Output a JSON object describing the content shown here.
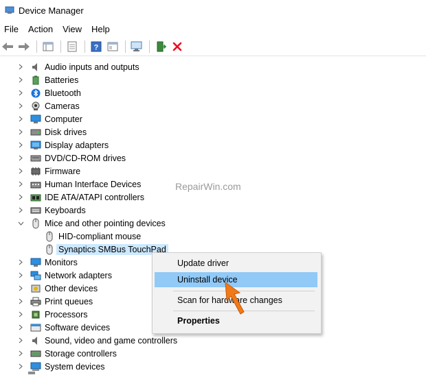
{
  "window": {
    "title": "Device Manager"
  },
  "menu": [
    "File",
    "Action",
    "View",
    "Help"
  ],
  "toolbar_icons": [
    "back-icon",
    "forward-icon",
    "tree-view-icon",
    "properties-icon",
    "help-icon",
    "panel-icon",
    "monitor-scan-icon",
    "update-driver-icon",
    "uninstall-x-icon"
  ],
  "tree": {
    "items": [
      {
        "label": "Audio inputs and outputs",
        "icon": "speaker-icon"
      },
      {
        "label": "Batteries",
        "icon": "battery-icon"
      },
      {
        "label": "Bluetooth",
        "icon": "bluetooth-icon"
      },
      {
        "label": "Cameras",
        "icon": "camera-icon"
      },
      {
        "label": "Computer",
        "icon": "computer-icon"
      },
      {
        "label": "Disk drives",
        "icon": "disk-icon"
      },
      {
        "label": "Display adapters",
        "icon": "display-adapter-icon"
      },
      {
        "label": "DVD/CD-ROM drives",
        "icon": "dvd-icon"
      },
      {
        "label": "Firmware",
        "icon": "firmware-icon"
      },
      {
        "label": "Human Interface Devices",
        "icon": "hid-icon"
      },
      {
        "label": "IDE ATA/ATAPI controllers",
        "icon": "ide-icon"
      },
      {
        "label": "Keyboards",
        "icon": "keyboard-icon"
      },
      {
        "label": "Mice and other pointing devices",
        "icon": "mouse-icon"
      },
      {
        "label": "HID-compliant mouse",
        "icon": "mouse-icon"
      },
      {
        "label": "Synaptics SMBus TouchPad",
        "icon": "mouse-icon"
      },
      {
        "label": "Monitors",
        "icon": "monitor-icon"
      },
      {
        "label": "Network adapters",
        "icon": "network-icon"
      },
      {
        "label": "Other devices",
        "icon": "other-devices-icon"
      },
      {
        "label": "Print queues",
        "icon": "printer-icon"
      },
      {
        "label": "Processors",
        "icon": "processor-icon"
      },
      {
        "label": "Software devices",
        "icon": "software-icon"
      },
      {
        "label": "Sound, video and game controllers",
        "icon": "sound-icon"
      },
      {
        "label": "Storage controllers",
        "icon": "storage-icon"
      },
      {
        "label": "System devices",
        "icon": "system-icon"
      }
    ]
  },
  "watermark": "RepairWin.com",
  "context_menu": {
    "items": [
      "Update driver",
      "Uninstall device",
      "Scan for hardware changes",
      "Properties"
    ]
  },
  "colors": {
    "selection": "#cce8ff",
    "menu_highlight": "#91c9f7",
    "cursor": "#f07a1a",
    "uninstall": "#e81123"
  }
}
